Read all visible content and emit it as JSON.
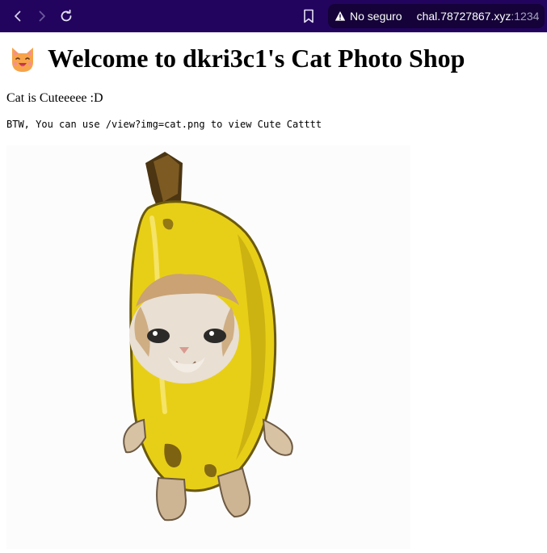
{
  "browser": {
    "security_label": "No seguro",
    "url_host": "chal.78727867.xyz",
    "url_port": ":1234",
    "icons": {
      "back": "chevron-left-icon",
      "forward": "chevron-right-icon",
      "reload": "reload-icon",
      "bookmark": "bookmark-icon",
      "warning": "warning-triangle-icon"
    },
    "colors": {
      "toolbar": "#22045e",
      "address_bar": "#140238"
    }
  },
  "page": {
    "title": "Welcome to dkri3c1's Cat Photo Shop",
    "title_icon": "cat-face-emoji-icon",
    "intro": "Cat is Cuteeeee :D",
    "hint": "BTW, You can use /view?img=cat.png to view Cute Catttt",
    "image": {
      "subject": "cat-in-banana-costume",
      "icon": "cat-photo-image"
    }
  }
}
